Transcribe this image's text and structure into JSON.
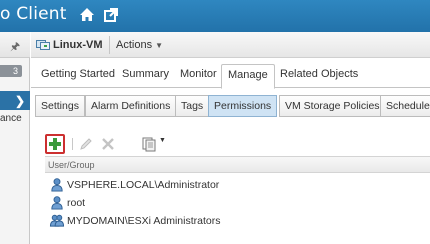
{
  "header": {
    "app_title": "o Client",
    "home_icon": "home-icon",
    "open_window_icon": "open-window-icon",
    "brand_color": "#2979b5"
  },
  "navigator": {
    "pin_icon": "pin-icon",
    "count_badge": "3",
    "partial_item": "ance",
    "chevron": "❯"
  },
  "object_bar": {
    "object_name": "Linux-VM",
    "actions_label": "Actions",
    "actions_caret": "▼"
  },
  "main_tabs": [
    {
      "label": "Getting Started"
    },
    {
      "label": "Summary"
    },
    {
      "label": "Monitor"
    },
    {
      "label": "Manage",
      "active": true
    },
    {
      "label": "Related Objects"
    }
  ],
  "sub_tabs": [
    {
      "label": "Settings"
    },
    {
      "label": "Alarm Definitions"
    },
    {
      "label": "Tags"
    },
    {
      "label": "Permissions",
      "active": true
    },
    {
      "label": "VM Storage Policies"
    },
    {
      "label": "Scheduled"
    }
  ],
  "toolbar": {
    "add_icon": "add-permission-icon",
    "edit_icon": "edit-icon",
    "delete_icon": "delete-icon",
    "export_icon": "export-icon",
    "add_highlight_color": "#cc2f2f"
  },
  "permissions_table": {
    "column_header": "User/Group",
    "rows": [
      {
        "principal": "VSPHERE.LOCAL\\Administrator",
        "icon": "user-icon"
      },
      {
        "principal": "root",
        "icon": "user-icon"
      },
      {
        "principal": "MYDOMAIN\\ESXi Administrators",
        "icon": "group-icon"
      }
    ]
  }
}
